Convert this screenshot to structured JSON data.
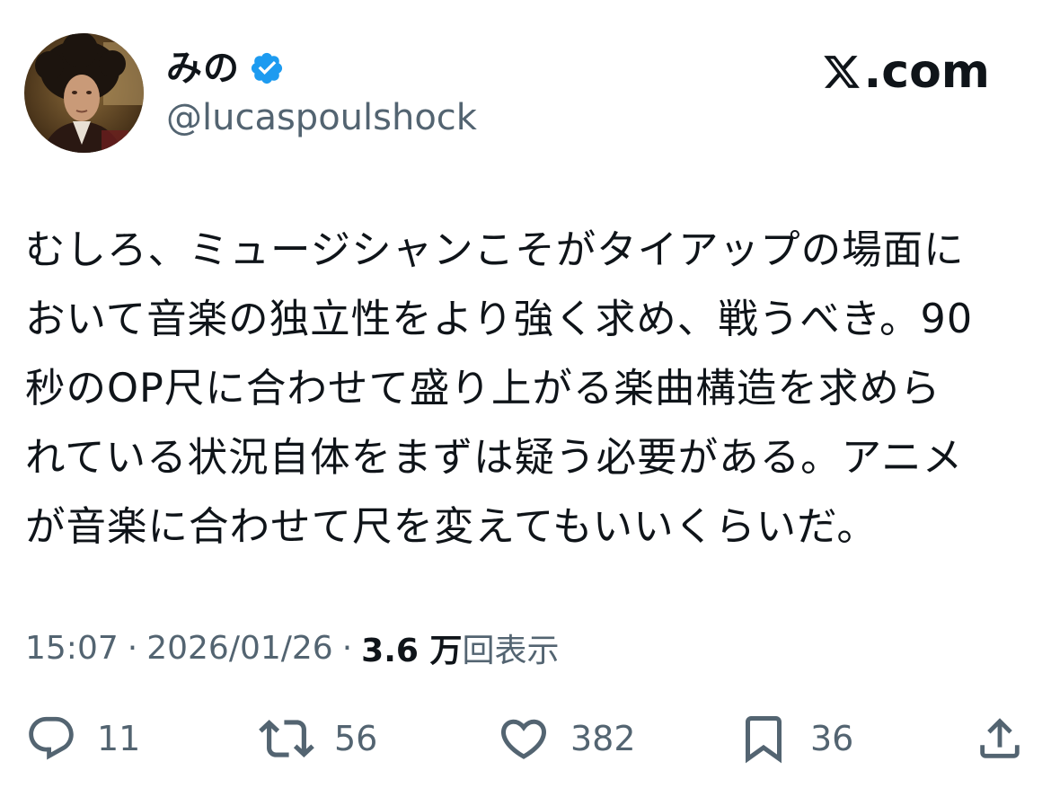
{
  "author": {
    "display_name": "みの",
    "handle": "@lucaspoulshock",
    "verified": true,
    "verified_icon": "verified-badge-icon",
    "verified_color": "#1d9bf0"
  },
  "brand": {
    "logo_icon": "x-logo-icon",
    "text": ".com"
  },
  "tweet": {
    "text": "むしろ、ミュージシャンこそがタイアップの場面に\nおいて音楽の独立性をより強く求め、戦うべき。90\n秒のOP尺に合わせて盛り上がる楽曲構造を求めら\nれている状況自体をまずは疑う必要がある。アニメ\nが音楽に合わせて尺を変えてもいいくらいだ。"
  },
  "meta": {
    "time": "15:07",
    "separator": "·",
    "date": "2026/01/26",
    "views_count": "3.6 万",
    "views_label": "回表示"
  },
  "actions": {
    "reply": {
      "icon": "reply-icon",
      "count": "11"
    },
    "retweet": {
      "icon": "retweet-icon",
      "count": "56"
    },
    "like": {
      "icon": "heart-icon",
      "count": "382"
    },
    "bookmark": {
      "icon": "bookmark-icon",
      "count": "36"
    },
    "share": {
      "icon": "share-icon"
    }
  },
  "colors": {
    "text_primary": "#0f1419",
    "text_secondary": "#536471",
    "accent": "#1d9bf0"
  }
}
